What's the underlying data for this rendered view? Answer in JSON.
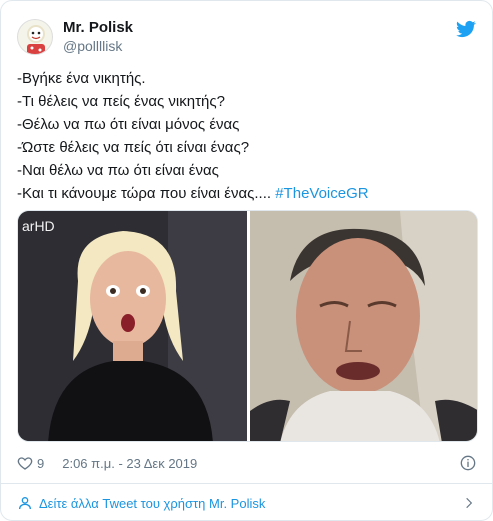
{
  "author": {
    "display_name": "Mr. Polisk",
    "handle": "@pollllisk"
  },
  "tweet": {
    "lines": [
      "-Βγήκε ένα νικητής.",
      "-Τι θέλεις να πείς ένας νικητής?",
      "-Θέλω να πω ότι είναι μόνος ένας",
      "-Ώστε θέλεις να πείς ότι είναι ένας?",
      "-Ναι θέλω να πω ότι είναι ένας",
      "-Και τι κάνουμε τώρα που είναι ένας...."
    ],
    "hashtag": "#TheVoiceGR"
  },
  "media": {
    "left_watermark": "arHD"
  },
  "footer": {
    "likes": "9",
    "timestamp": "2:06 π.μ. - 23 Δεκ 2019"
  },
  "more_link": "Δείτε άλλα Tweet του χρήστη Mr. Polisk",
  "colors": {
    "accent": "#1b95e0",
    "text": "#14171a",
    "muted": "#657786",
    "border": "#e1e8ed"
  },
  "icons": [
    "twitter-bird-icon",
    "heart-icon",
    "info-icon",
    "person-icon",
    "chevron-right-icon"
  ]
}
